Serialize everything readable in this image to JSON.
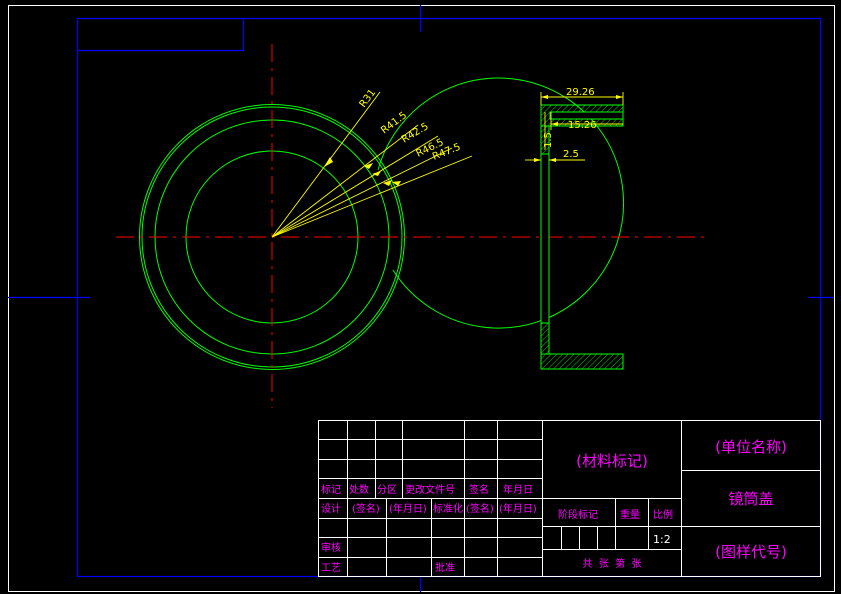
{
  "drawing": {
    "radius_labels": [
      "R31",
      "R41.5",
      "R42.5",
      "R46.5",
      "R47.5"
    ],
    "dims": {
      "width_top": "29.26",
      "width_inner": "15.26",
      "thickness": "2.5",
      "lip": "1.5"
    }
  },
  "title_block": {
    "row_headers": [
      "标记",
      "处数",
      "分区",
      "更改文件号",
      "签名",
      "年月日"
    ],
    "design_row": [
      "设计",
      "(签名)",
      "(年月日)",
      "标准化",
      "(签名)",
      "(年月日)"
    ],
    "review": "审核",
    "process": "工艺",
    "approve": "批准",
    "material": "(材料标记)",
    "company": "(单位名称)",
    "part_name": "镜筒盖",
    "drawing_code": "(图样代号)",
    "stage_label": "阶段标记",
    "weight_label": "重量",
    "scale_label": "比例",
    "scale_value": "1:2",
    "sheets": "共  张  第  张"
  },
  "colors": {
    "border": "#0000ff",
    "geometry": "#00ff00",
    "centerline": "#ff0000",
    "dimension": "#ffff00",
    "title_text": "#ff00ff"
  }
}
